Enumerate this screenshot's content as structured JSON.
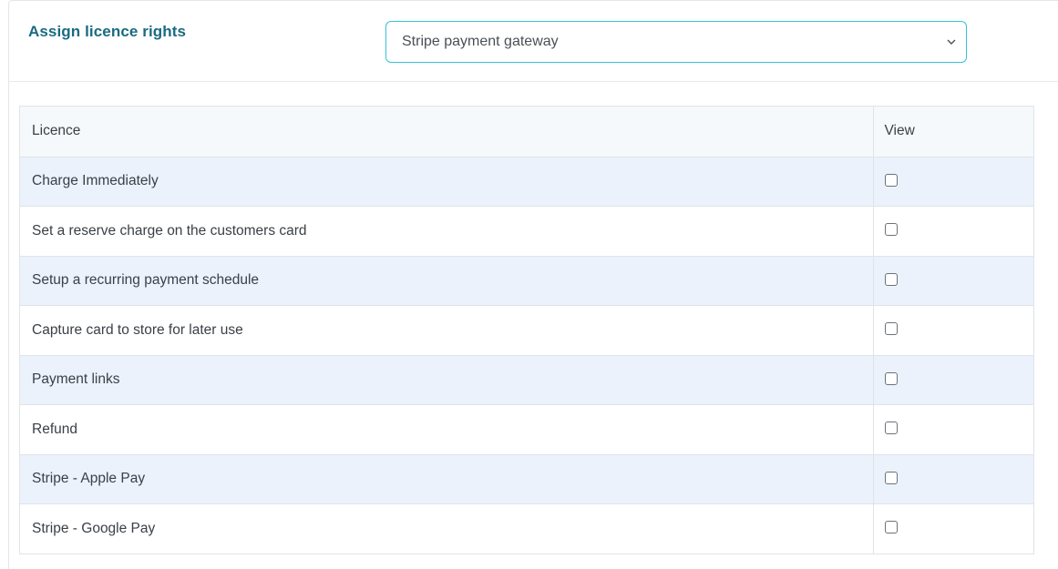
{
  "header": {
    "title": "Assign licence rights",
    "gateway_select": {
      "value": "Stripe payment gateway",
      "icon": "chevron-down-icon"
    }
  },
  "table": {
    "columns": [
      "Licence",
      "View"
    ],
    "rows": [
      {
        "licence": "Charge Immediately",
        "view": false
      },
      {
        "licence": "Set a reserve charge on the customers card",
        "view": false
      },
      {
        "licence": "Setup a recurring payment schedule",
        "view": false
      },
      {
        "licence": "Capture card to store for later use",
        "view": false
      },
      {
        "licence": "Payment links",
        "view": false
      },
      {
        "licence": "Refund",
        "view": false
      },
      {
        "licence": "Stripe - Apple Pay",
        "view": false
      },
      {
        "licence": "Stripe - Google Pay",
        "view": false
      }
    ]
  },
  "colors": {
    "title": "#1a6b80",
    "select_border": "#35c3d8",
    "stripe_row": "#ecf2fc",
    "header_row": "#f5f9fb"
  }
}
